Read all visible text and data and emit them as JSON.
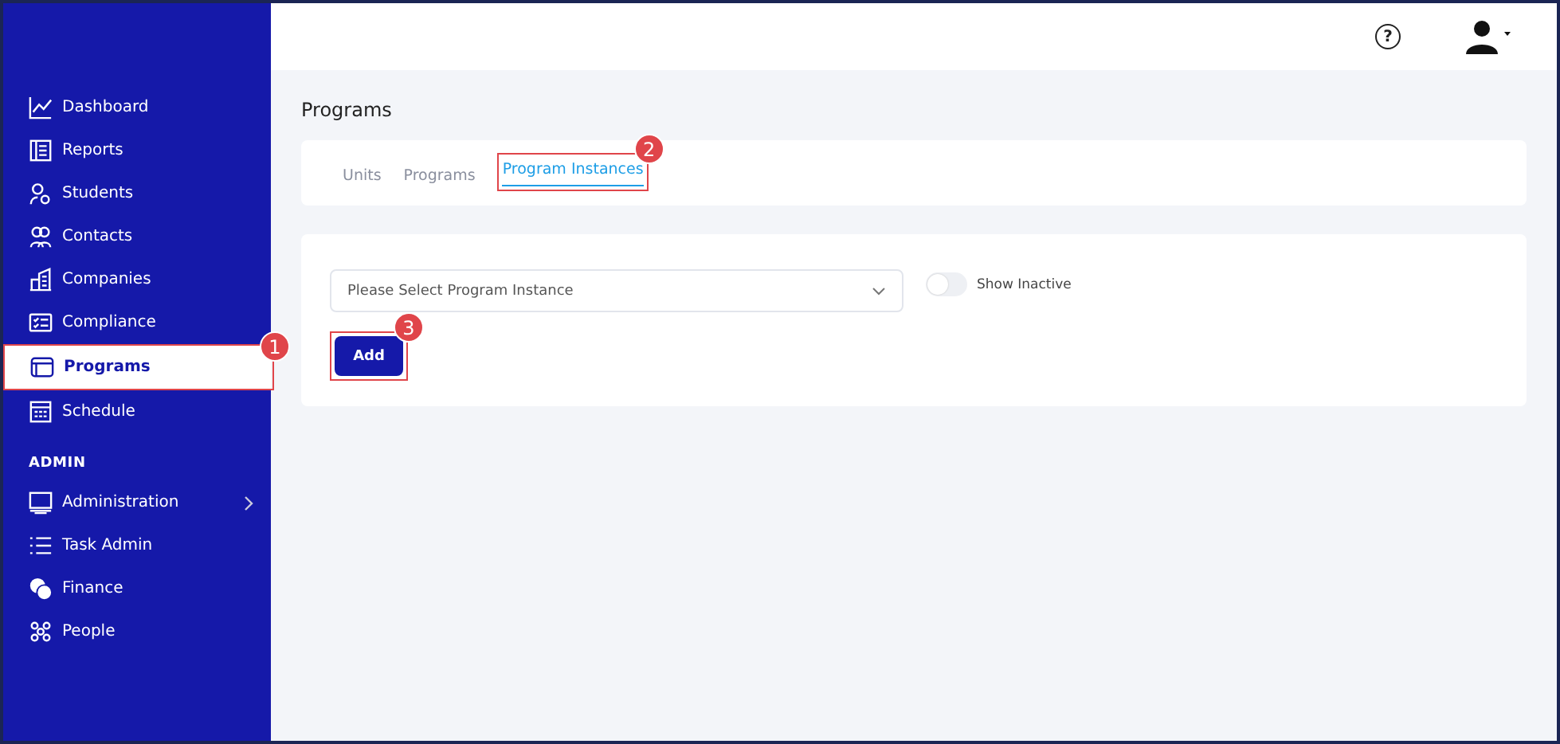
{
  "topbar": {
    "help": "?"
  },
  "sidebar": {
    "items": [
      {
        "label": "Dashboard",
        "selected": false
      },
      {
        "label": "Reports",
        "selected": false
      },
      {
        "label": "Students",
        "selected": false
      },
      {
        "label": "Contacts",
        "selected": false
      },
      {
        "label": "Companies",
        "selected": false
      },
      {
        "label": "Compliance",
        "selected": false
      },
      {
        "label": "Programs",
        "selected": true,
        "callout": "1"
      },
      {
        "label": "Schedule",
        "selected": false
      }
    ],
    "section": {
      "title": "ADMIN",
      "items": [
        {
          "label": "Administration",
          "selected": false,
          "kind": "submenu"
        },
        {
          "label": "Task Admin",
          "selected": false,
          "kind": "link"
        },
        {
          "label": "Finance",
          "selected": false,
          "kind": "link"
        },
        {
          "label": "People",
          "selected": false,
          "kind": "link"
        }
      ]
    }
  },
  "page": {
    "title": "Programs",
    "tabs": [
      {
        "label": "Units",
        "selected": false
      },
      {
        "label": "Programs",
        "selected": false
      },
      {
        "label": "Program Instances",
        "selected": true,
        "callout": "2"
      }
    ],
    "select": {
      "placeholder": "Please Select Program Instance"
    },
    "toggle": {
      "label": "Show Inactive",
      "on": false
    },
    "button": {
      "label": "Add",
      "callout": "3"
    }
  }
}
